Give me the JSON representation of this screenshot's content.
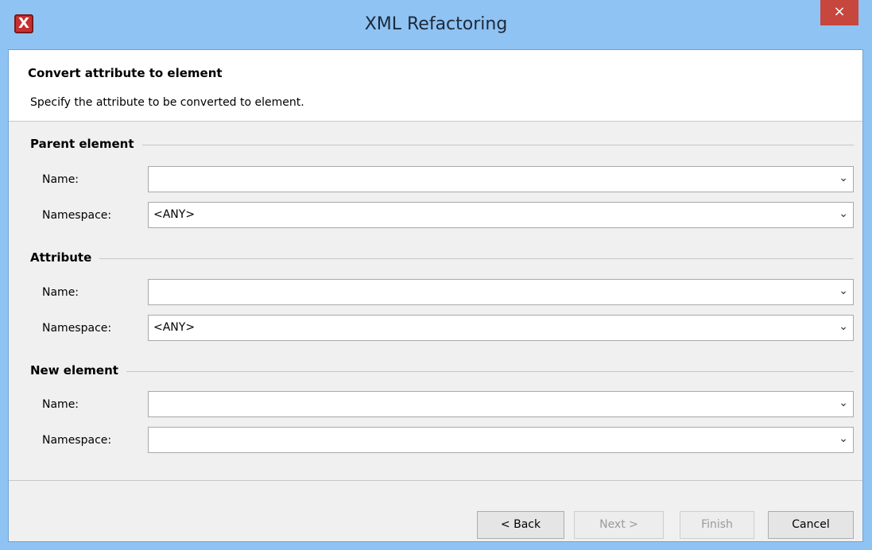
{
  "window": {
    "title": "XML Refactoring",
    "close_label": "×",
    "app_icon_label": "X"
  },
  "header": {
    "title": "Convert attribute to element",
    "description": "Specify the attribute to be converted to element."
  },
  "groups": [
    {
      "label": "Parent element",
      "fields": [
        {
          "label": "Name:",
          "value": ""
        },
        {
          "label": "Namespace:",
          "value": "<ANY>"
        }
      ]
    },
    {
      "label": "Attribute",
      "fields": [
        {
          "label": "Name:",
          "value": ""
        },
        {
          "label": "Namespace:",
          "value": "<ANY>"
        }
      ]
    },
    {
      "label": "New element",
      "fields": [
        {
          "label": "Name:",
          "value": ""
        },
        {
          "label": "Namespace:",
          "value": ""
        }
      ]
    }
  ],
  "dropdown_icon": "⌄",
  "buttons": {
    "back": "< Back",
    "next": "Next >",
    "finish": "Finish",
    "cancel": "Cancel"
  }
}
